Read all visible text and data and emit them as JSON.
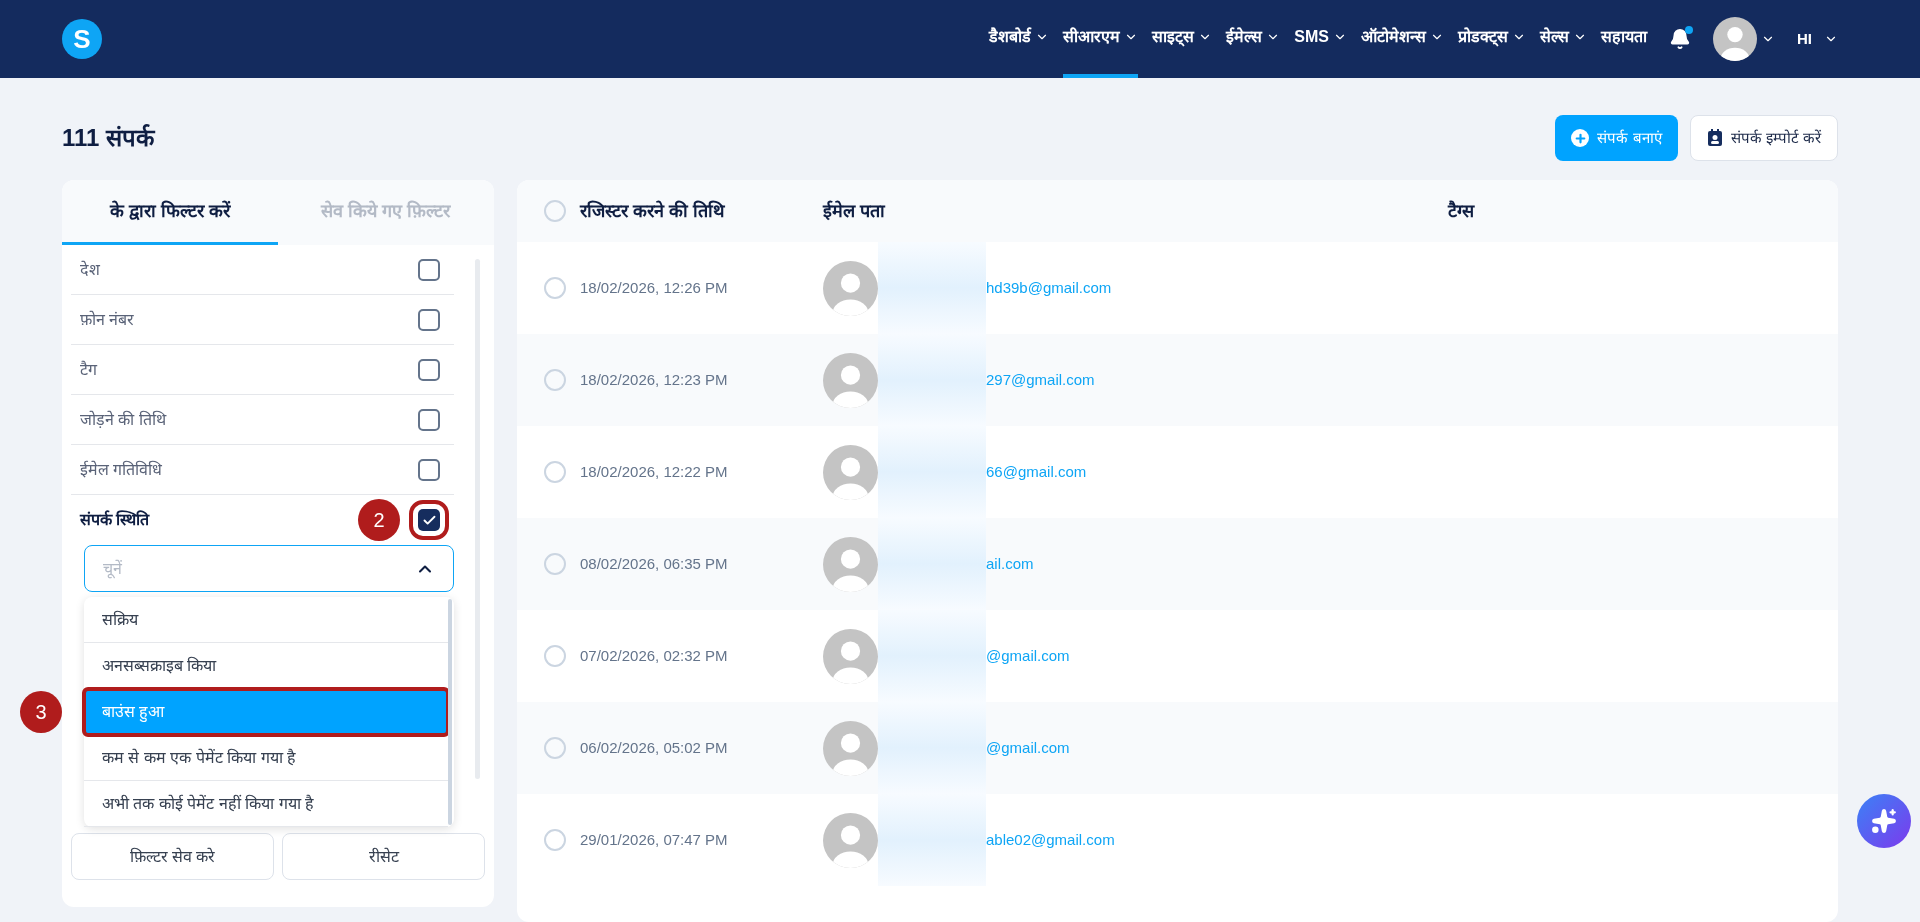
{
  "logo": "S",
  "nav": [
    {
      "label": "डैशबोर्ड",
      "dropdown": true,
      "selected": false
    },
    {
      "label": "सीआरएम",
      "dropdown": true,
      "selected": true
    },
    {
      "label": "साइट्स",
      "dropdown": true,
      "selected": false
    },
    {
      "label": "ईमेल्स",
      "dropdown": true,
      "selected": false
    },
    {
      "label": "SMS",
      "dropdown": true,
      "selected": false
    },
    {
      "label": "ऑटोमेशन्स",
      "dropdown": true,
      "selected": false
    },
    {
      "label": "प्रोडक्ट्स",
      "dropdown": true,
      "selected": false
    },
    {
      "label": "सेल्स",
      "dropdown": true,
      "selected": false
    },
    {
      "label": "सहायता",
      "dropdown": false,
      "selected": false
    }
  ],
  "notifications": {
    "unread": true
  },
  "language": "HI",
  "page_title": "111 संपर्क",
  "actions": [
    {
      "kind": "primary",
      "label": "संपर्क बनाएं"
    },
    {
      "kind": "secondary",
      "label": "संपर्क इम्पोर्ट करें"
    }
  ],
  "filter_tabs": [
    {
      "label": "के द्वारा फिल्टर करें",
      "selected": true
    },
    {
      "label": "सेव किये गए फ़िल्टर",
      "selected": false
    }
  ],
  "filters": [
    {
      "label": "देश",
      "checked": false
    },
    {
      "label": "फ़ोन नंबर",
      "checked": false
    },
    {
      "label": "टैग",
      "checked": false
    },
    {
      "label": "जोड़ने की तिथि",
      "checked": false
    },
    {
      "label": "ईमेल गतिविधि",
      "checked": false
    }
  ],
  "status_filter": {
    "label": "संपर्क स्थिति",
    "checked": true,
    "annotation": "2",
    "placeholder": "चूनें",
    "expanded": true,
    "options": [
      {
        "label": "सक्रिय",
        "selected": false
      },
      {
        "label": "अनसब्सक्राइब किया",
        "selected": false
      },
      {
        "label": "बाउंस हुआ",
        "selected": true,
        "annotation": "3"
      },
      {
        "label": "कम से कम एक पेमेंट किया गया है",
        "selected": false
      },
      {
        "label": "अभी तक कोई पेमेंट नहीं किया गया है",
        "selected": false
      }
    ]
  },
  "filter_buttons": [
    "फ़िल्टर सेव करे",
    "रीसेट"
  ],
  "table": {
    "all_selected": false,
    "columns": [
      "रजिस्टर करने की तिथि",
      "ईमेल पता",
      "टैग्स"
    ],
    "rows": [
      {
        "date": "18/02/2026, 12:26 PM",
        "email": "hd39b@gmail.com",
        "selected": false
      },
      {
        "date": "18/02/2026, 12:23 PM",
        "email": "297@gmail.com",
        "selected": false
      },
      {
        "date": "18/02/2026, 12:22 PM",
        "email": "66@gmail.com",
        "selected": false
      },
      {
        "date": "08/02/2026, 06:35 PM",
        "email": "ail.com",
        "selected": false
      },
      {
        "date": "07/02/2026, 02:32 PM",
        "email": "@gmail.com",
        "selected": false
      },
      {
        "date": "06/02/2026, 05:02 PM",
        "email": "@gmail.com",
        "selected": false
      },
      {
        "date": "29/01/2026, 07:47 PM",
        "email": "able02@gmail.com",
        "selected": false
      }
    ]
  }
}
